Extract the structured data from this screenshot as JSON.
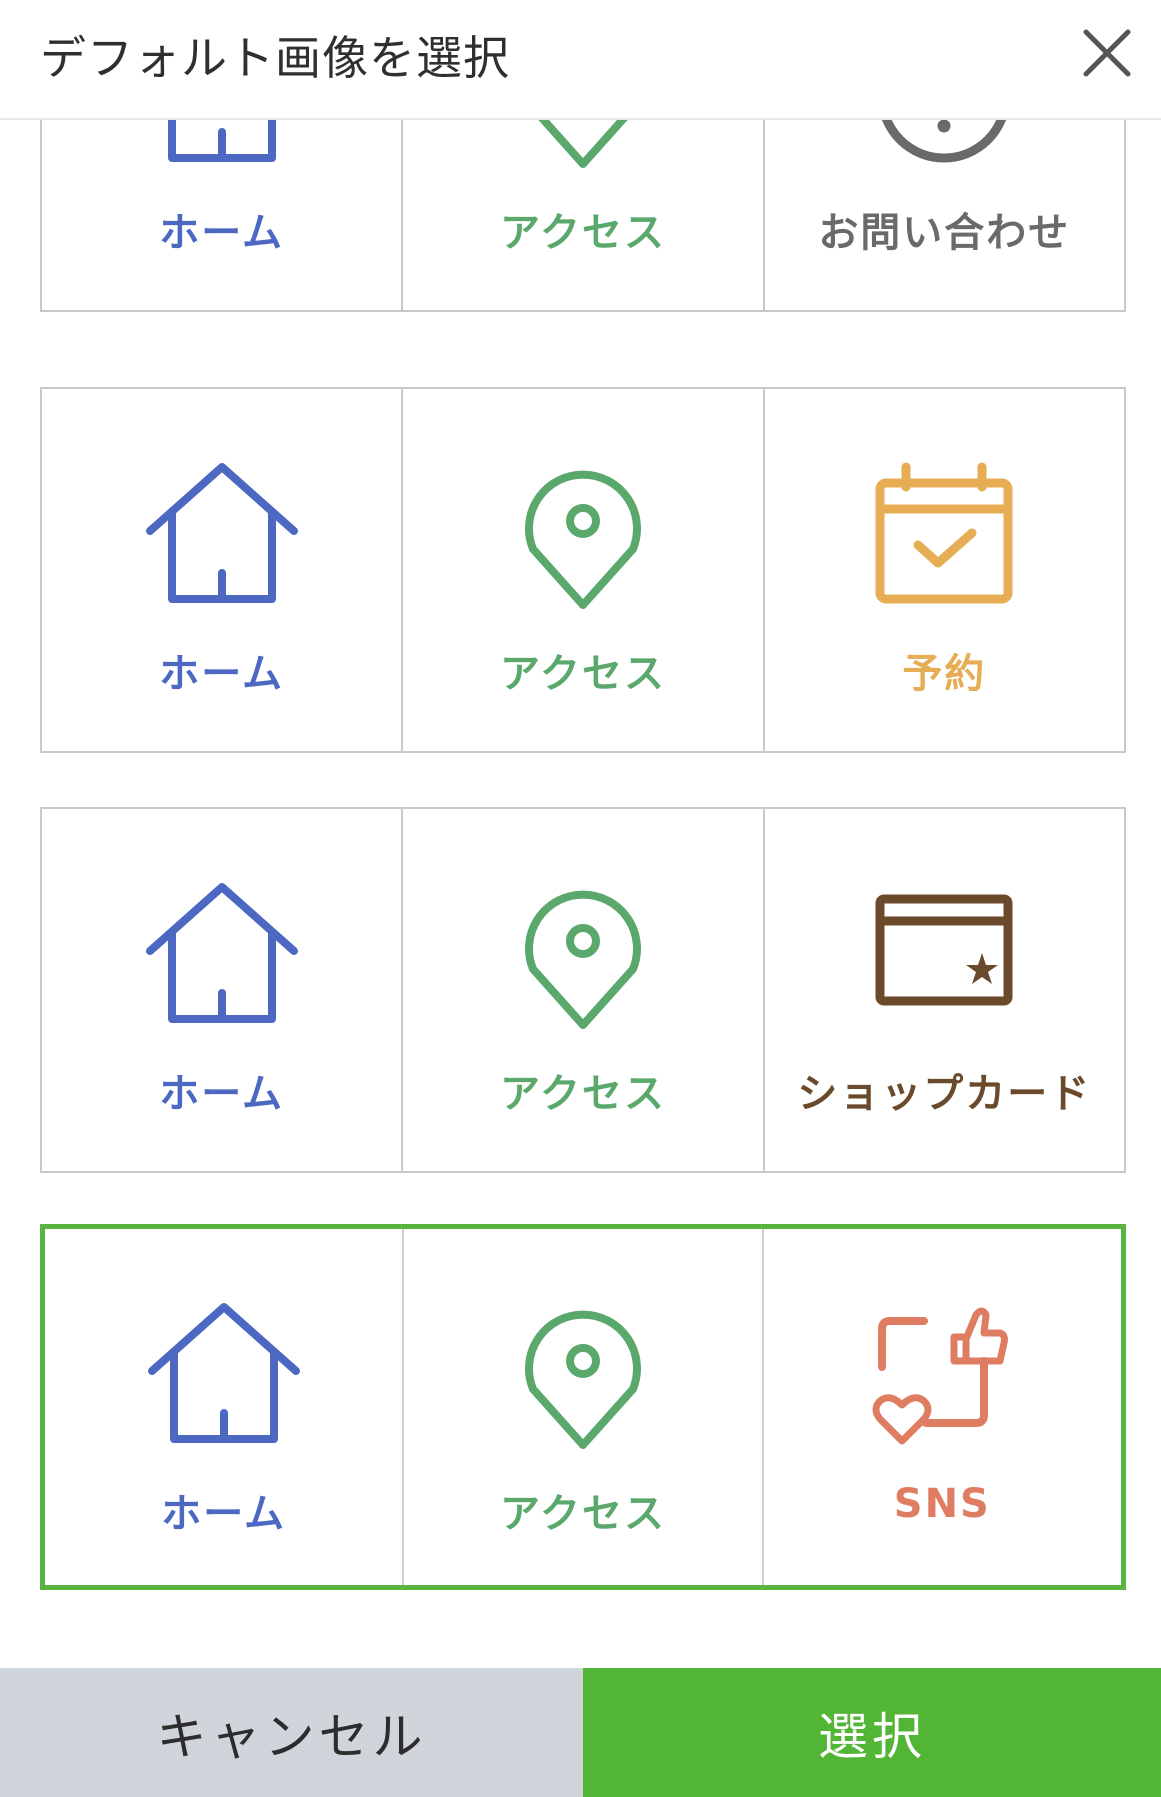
{
  "header": {
    "title": "デフォルト画像を選択",
    "close_icon": "close-icon"
  },
  "options": [
    {
      "selected": false,
      "items": [
        {
          "label": "ホーム",
          "icon": "home-icon",
          "color": "#4c68c2"
        },
        {
          "label": "アクセス",
          "icon": "location-pin-icon",
          "color": "#5aa86c"
        },
        {
          "label": "お問い合わせ",
          "icon": "info-icon",
          "color": "#6a6a6a"
        }
      ]
    },
    {
      "selected": false,
      "items": [
        {
          "label": "ホーム",
          "icon": "home-icon",
          "color": "#4c68c2"
        },
        {
          "label": "アクセス",
          "icon": "location-pin-icon",
          "color": "#5aa86c"
        },
        {
          "label": "予約",
          "icon": "calendar-check-icon",
          "color": "#e6ad54"
        }
      ]
    },
    {
      "selected": false,
      "items": [
        {
          "label": "ホーム",
          "icon": "home-icon",
          "color": "#4c68c2"
        },
        {
          "label": "アクセス",
          "icon": "location-pin-icon",
          "color": "#5aa86c"
        },
        {
          "label": "ショップカード",
          "icon": "shop-card-icon",
          "color": "#6b4a2c"
        }
      ]
    },
    {
      "selected": true,
      "items": [
        {
          "label": "ホーム",
          "icon": "home-icon",
          "color": "#4c68c2"
        },
        {
          "label": "アクセス",
          "icon": "location-pin-icon",
          "color": "#5aa86c"
        },
        {
          "label": "SNS",
          "icon": "sns-icon",
          "color": "#df7d62"
        }
      ]
    }
  ],
  "footer": {
    "cancel_label": "キャンセル",
    "select_label": "選択"
  },
  "colors": {
    "accent": "#52b535",
    "selected_border": "#5ab540",
    "cancel_bg": "#d0d4db"
  }
}
